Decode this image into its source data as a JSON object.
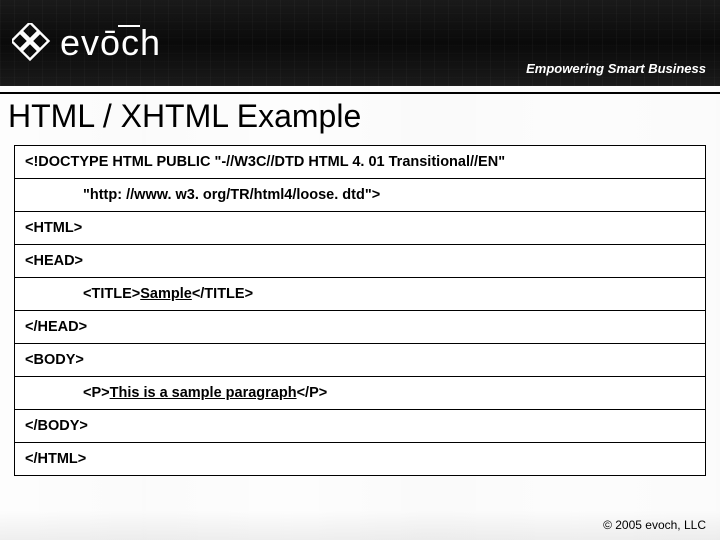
{
  "header": {
    "logo_text": "evōch",
    "tagline": "Empowering Smart Business"
  },
  "title": "HTML / XHTML Example",
  "code": {
    "line1": "<!DOCTYPE HTML PUBLIC \"-//W3C//DTD HTML 4. 01 Transitional//EN\"",
    "line2": "\"http: //www. w3. org/TR/html4/loose. dtd\">",
    "line3": "<HTML>",
    "line4": "<HEAD>",
    "line5_pre": "<TITLE>",
    "line5_mid": "Sample",
    "line5_post": "</TITLE>",
    "line6": "</HEAD>",
    "line7": "<BODY>",
    "line8_pre": "<P>",
    "line8_mid": "This is a sample paragraph",
    "line8_post": "</P>",
    "line9": "</BODY>",
    "line10": "</HTML>"
  },
  "footer": "© 2005  evoch, LLC"
}
